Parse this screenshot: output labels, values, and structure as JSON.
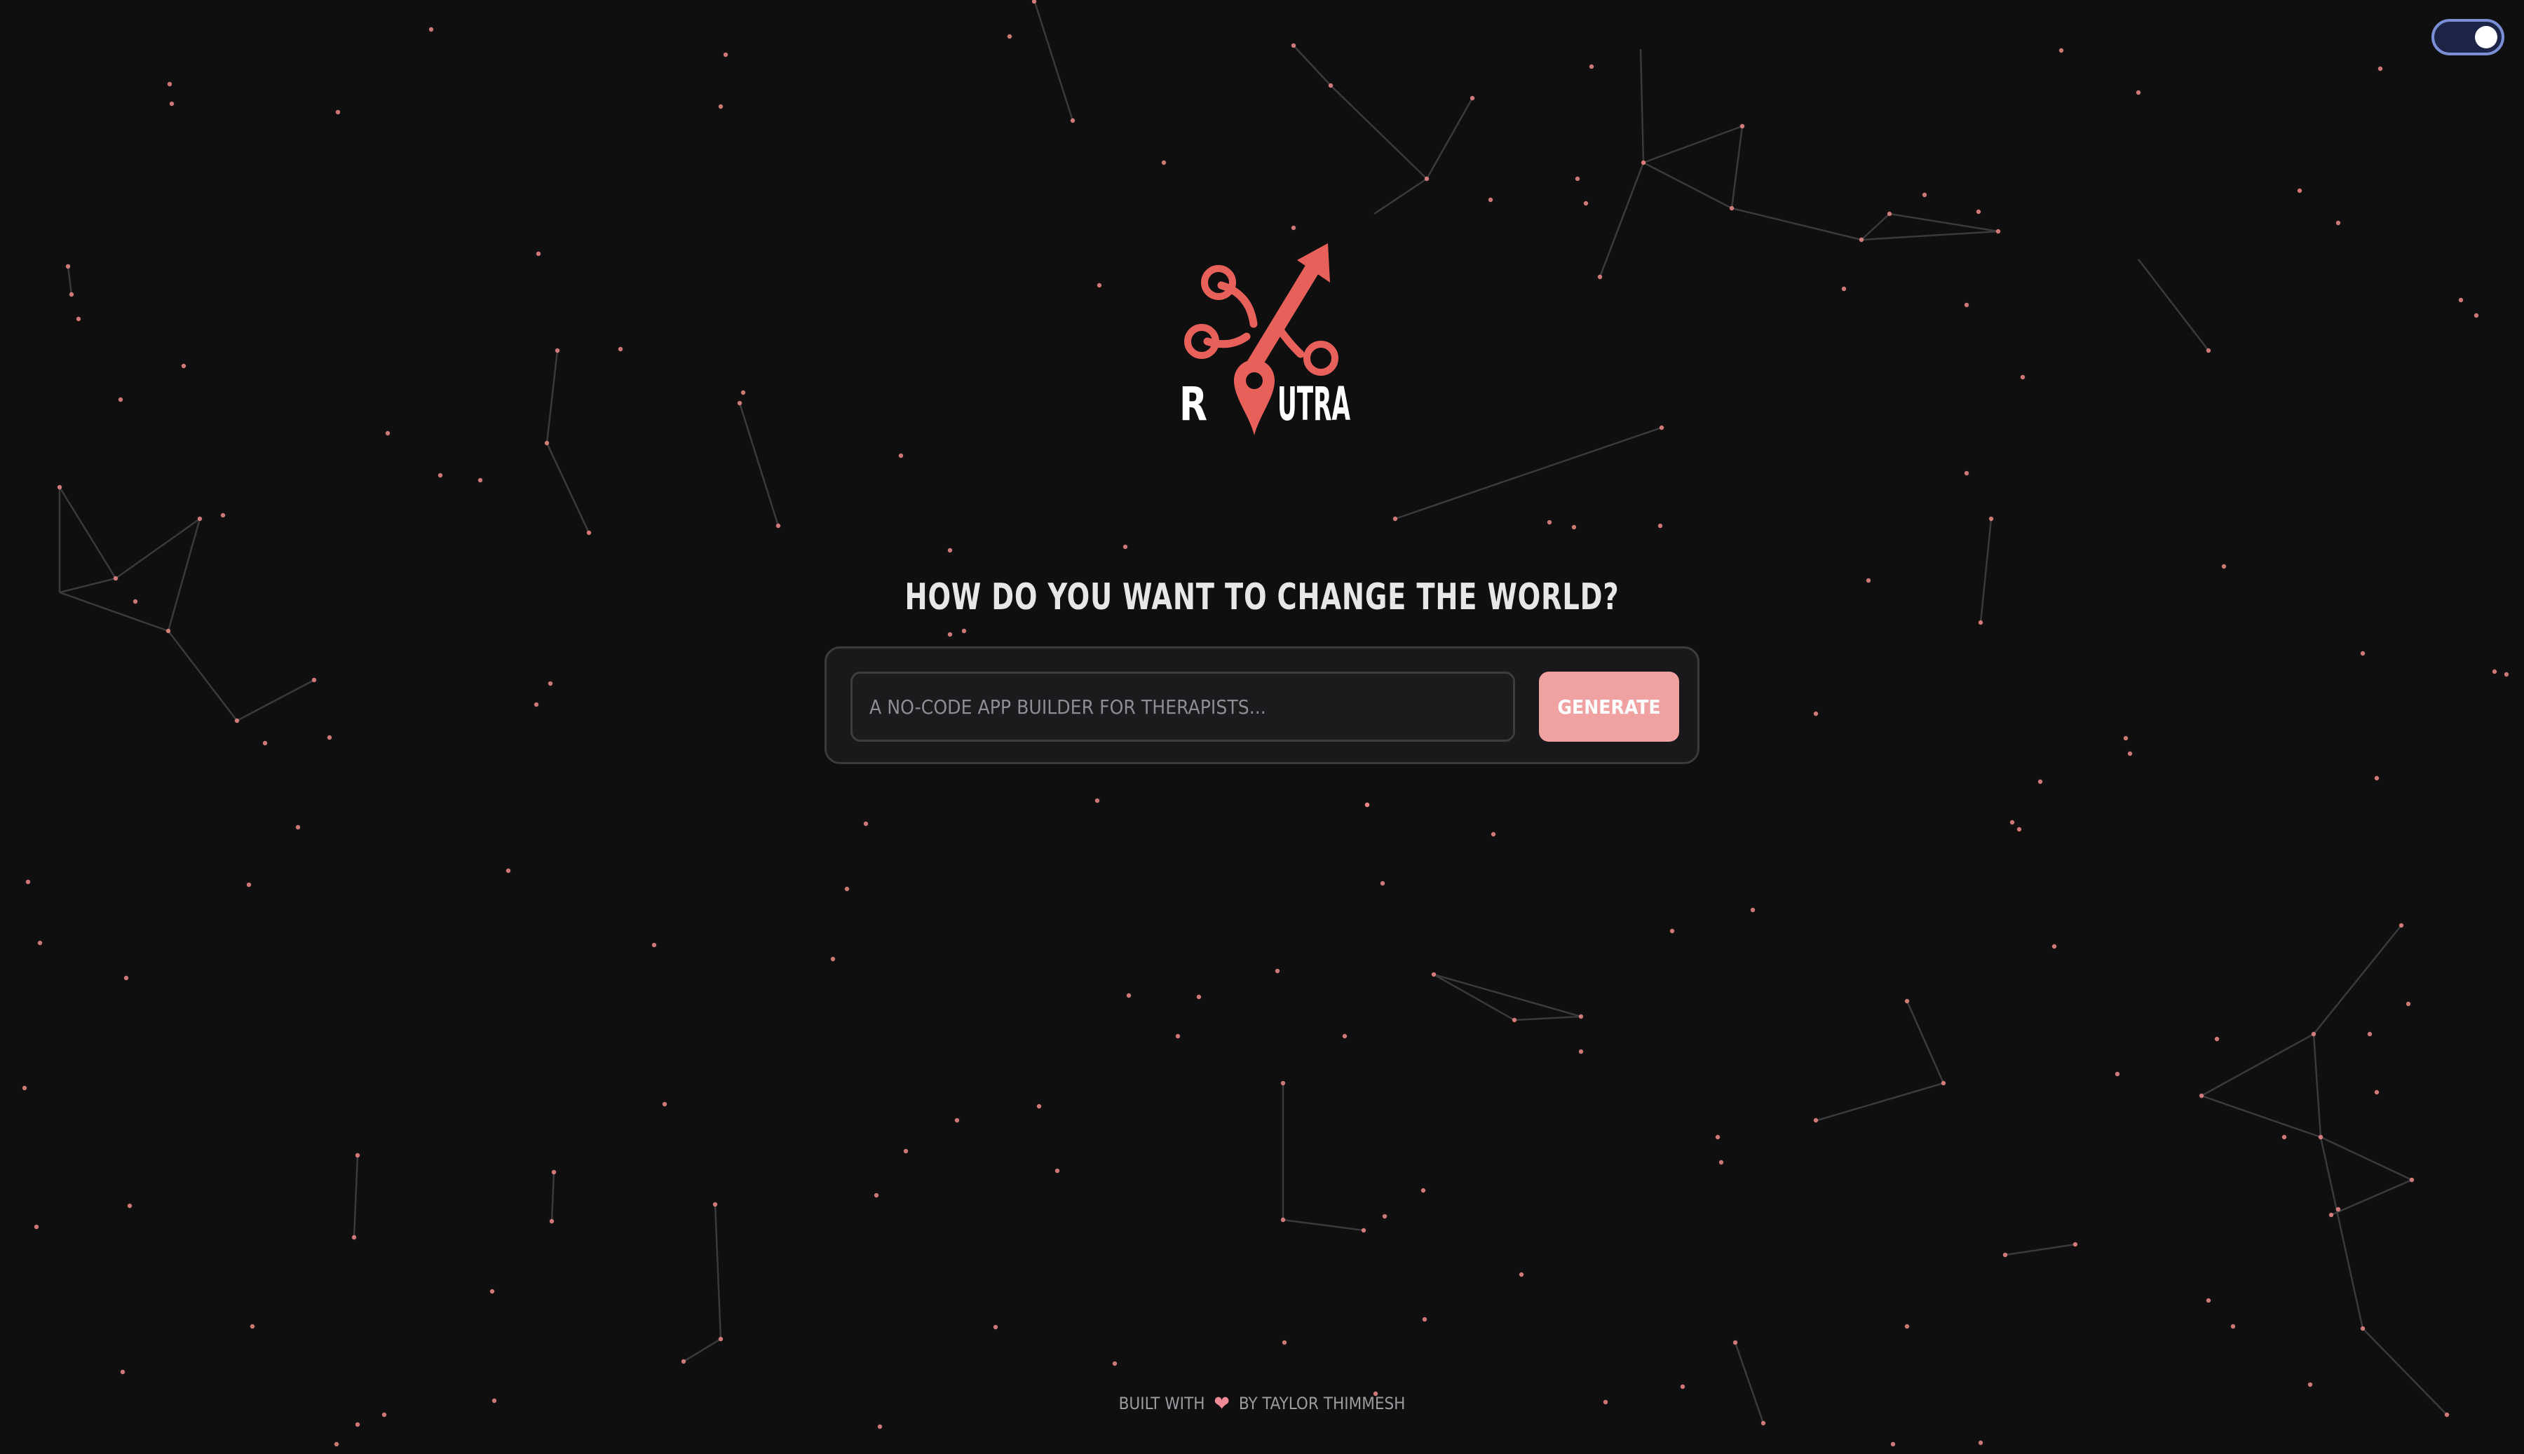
{
  "theme_toggle": {
    "state": "on",
    "track_color": "#1c2547",
    "border_color": "#7b8fd6"
  },
  "logo": {
    "wordmark": "ROUTRA",
    "brand_color": "#e8605a",
    "text_color": "#ffffff"
  },
  "headline": "HOW DO YOU WANT TO CHANGE THE WORLD?",
  "prompt": {
    "placeholder": "A NO-CODE APP BUILDER FOR THERAPISTS...",
    "value": "",
    "button_label": "GENERATE",
    "button_color": "#f0a2a2"
  },
  "footer": {
    "prefix": "BUILT WITH",
    "icon": "heart-icon",
    "suffix": "BY TAYLOR THIMMESH"
  },
  "colors": {
    "background": "#0f0f10",
    "star": "#f08a8a",
    "constellation_line": "#3a3a3d"
  }
}
